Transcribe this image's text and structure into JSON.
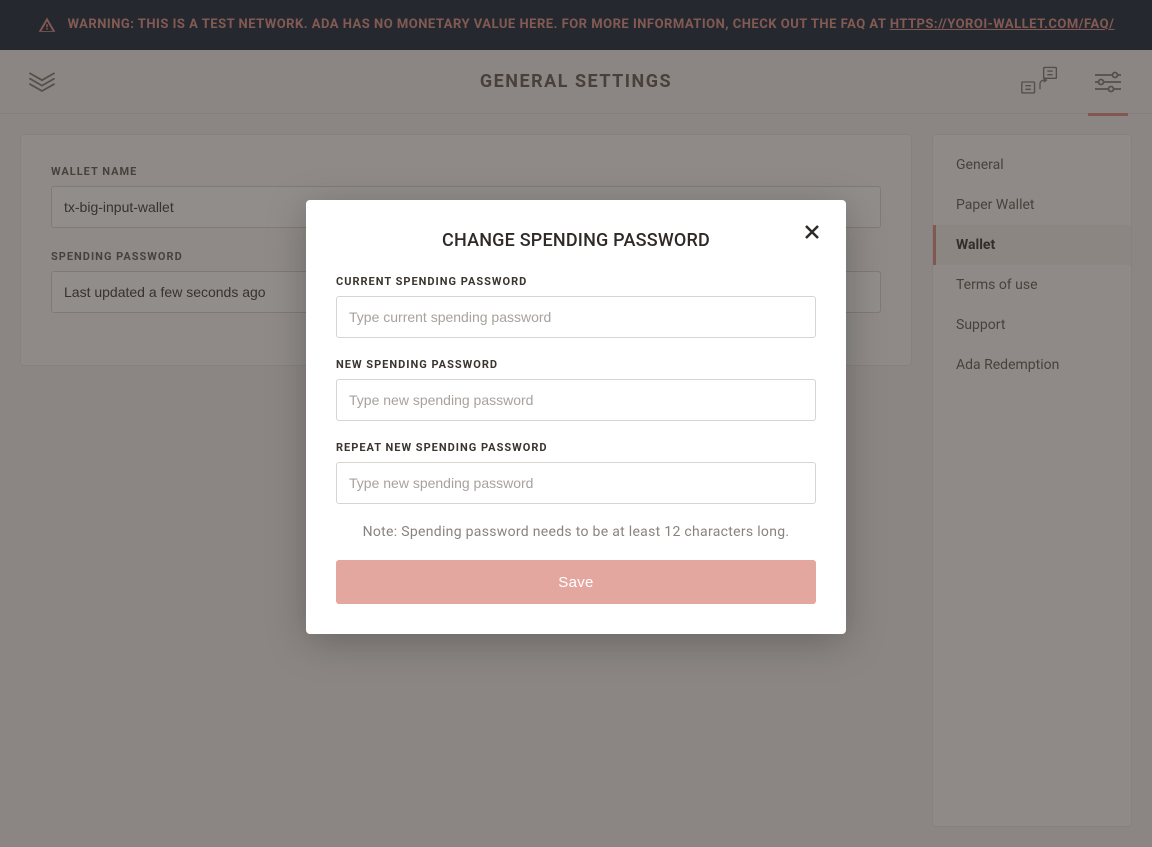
{
  "banner": {
    "text_before_link": "WARNING: THIS IS A TEST NETWORK. ADA HAS NO MONETARY VALUE HERE. FOR MORE INFORMATION, CHECK OUT THE FAQ AT ",
    "link_text": "HTTPS://YOROI-WALLET.COM/FAQ/"
  },
  "header": {
    "title": "GENERAL SETTINGS"
  },
  "main": {
    "wallet_name_label": "WALLET NAME",
    "wallet_name_value": "tx-big-input-wallet",
    "spending_password_label": "SPENDING PASSWORD",
    "spending_password_value": "Last updated a few seconds ago"
  },
  "sidebar": {
    "items": [
      {
        "label": "General",
        "active": false
      },
      {
        "label": "Paper Wallet",
        "active": false
      },
      {
        "label": "Wallet",
        "active": true
      },
      {
        "label": "Terms of use",
        "active": false
      },
      {
        "label": "Support",
        "active": false
      },
      {
        "label": "Ada Redemption",
        "active": false
      }
    ]
  },
  "modal": {
    "title": "CHANGE SPENDING PASSWORD",
    "current_label": "CURRENT SPENDING PASSWORD",
    "current_placeholder": "Type current spending password",
    "new_label": "NEW SPENDING PASSWORD",
    "new_placeholder": "Type new spending password",
    "repeat_label": "REPEAT NEW SPENDING PASSWORD",
    "repeat_placeholder": "Type new spending password",
    "note": "Note: Spending password needs to be at least 12 characters long.",
    "save_label": "Save"
  }
}
